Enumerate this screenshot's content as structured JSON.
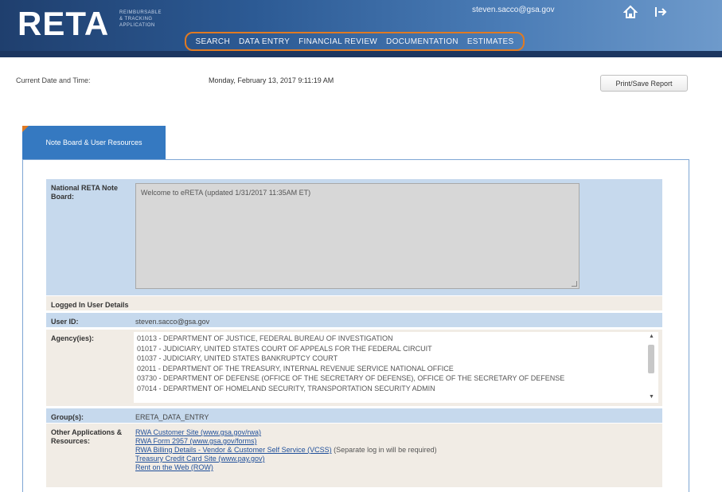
{
  "header": {
    "logo": "RETA",
    "logo_sub": [
      "REIMBURSABLE",
      "& TRACKING",
      "APPLICATION"
    ],
    "user_email": "steven.sacco@gsa.gov",
    "nav": [
      "SEARCH",
      "DATA ENTRY",
      "FINANCIAL REVIEW",
      "DOCUMENTATION",
      "ESTIMATES"
    ],
    "accent_color": "#e07a22",
    "home_icon": "home-icon",
    "signout_icon": "signout-icon"
  },
  "date_row": {
    "label": "Current Date and Time:",
    "value": "Monday, February 13, 2017 9:11:19 AM",
    "print_button": "Print/Save Report"
  },
  "tab": {
    "label": "Note Board & User Resources"
  },
  "note_board": {
    "label": "National RETA Note Board:",
    "text": "Welcome to eRETA (updated 1/31/2017 11:35AM ET)"
  },
  "logged_in": {
    "heading": "Logged In User Details"
  },
  "user_id": {
    "label": "User ID:",
    "value": "steven.sacco@gsa.gov"
  },
  "agencies": {
    "label": "Agency(ies):",
    "items": [
      "01013 - DEPARTMENT OF JUSTICE, FEDERAL BUREAU OF INVESTIGATION",
      "01017 - JUDICIARY, UNITED STATES COURT OF APPEALS FOR THE FEDERAL CIRCUIT",
      "01037 - JUDICIARY, UNITED STATES BANKRUPTCY COURT",
      "02011 - DEPARTMENT OF THE TREASURY, INTERNAL REVENUE SERVICE NATIONAL OFFICE",
      "03730 - DEPARTMENT OF DEFENSE (OFFICE OF THE SECRETARY OF DEFENSE), OFFICE OF THE SECRETARY OF DEFENSE",
      "07014 - DEPARTMENT OF HOMELAND SECURITY, TRANSPORTATION SECURITY ADMIN"
    ]
  },
  "groups": {
    "label": "Group(s):",
    "value": "ERETA_DATA_ENTRY"
  },
  "other_apps": {
    "label": "Other Applications & Resources:",
    "links": [
      "RWA Customer Site (www.gsa.gov/rwa)",
      "RWA Form 2957 (www.gsa.gov/forms)",
      "RWA Billing Details - Vendor & Customer Self Service (VCSS)",
      "Treasury Credit Card Site (www.pay.gov)",
      "Rent on the Web (ROW)"
    ],
    "link_note": "(Separate log in will be required)"
  }
}
